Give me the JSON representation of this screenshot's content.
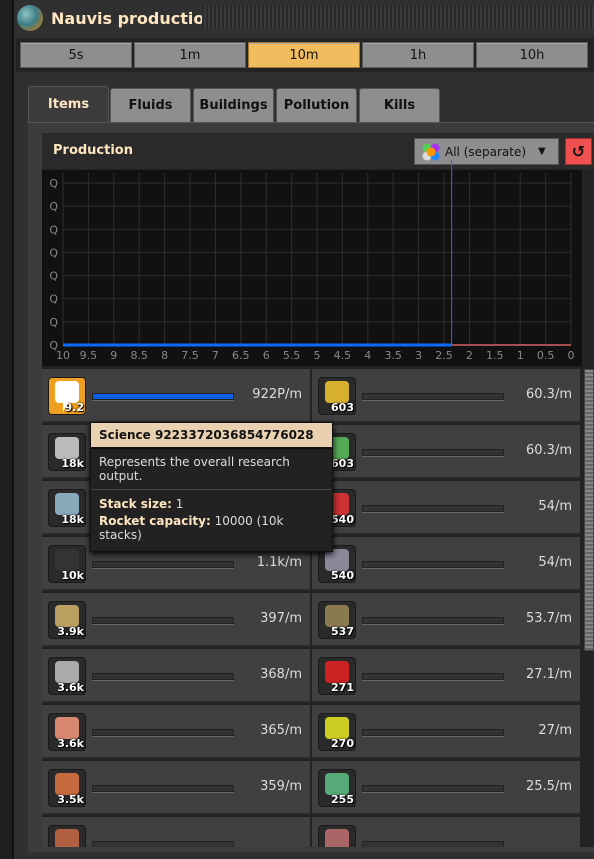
{
  "window": {
    "title": "Nauvis production"
  },
  "time_buttons": [
    {
      "label": "5s"
    },
    {
      "label": "1m"
    },
    {
      "label": "10m",
      "selected": true
    },
    {
      "label": "1h"
    },
    {
      "label": "10h"
    }
  ],
  "tabs": [
    {
      "label": "Items",
      "selected": true
    },
    {
      "label": "Fluids"
    },
    {
      "label": "Buildings"
    },
    {
      "label": "Pollution"
    },
    {
      "label": "Kills"
    }
  ],
  "panel": {
    "title": "Production",
    "filter_dropdown": "All (separate)",
    "reset_icon": "reset-icon"
  },
  "chart_data": {
    "type": "line",
    "x_ticks": [
      "10",
      "9.5",
      "9",
      "8.5",
      "8",
      "7.5",
      "7",
      "6.5",
      "6",
      "5.5",
      "5",
      "4.5",
      "4",
      "3.5",
      "3",
      "2.5",
      "2",
      "1.5",
      "1",
      "0.5",
      "0"
    ],
    "y_ticks": [
      "Q",
      "Q",
      "Q",
      "Q",
      "Q",
      "Q",
      "Q",
      "Q"
    ],
    "xlim": [
      10,
      0
    ],
    "grid": true,
    "cursor_x": 2.35,
    "series": [
      {
        "color": "#0a6cff",
        "points": [
          [
            10,
            0
          ],
          [
            2.35,
            0
          ]
        ]
      },
      {
        "color": "#a05050",
        "points": [
          [
            2.35,
            0
          ],
          [
            0,
            0
          ]
        ]
      }
    ]
  },
  "items_left": [
    {
      "icon": "science-icon",
      "count": "9.2",
      "rate": "922P/m",
      "fill": 1,
      "selected": true
    },
    {
      "icon": "stone-brick-icon",
      "count": "18k",
      "rate": "",
      "fill": 0
    },
    {
      "icon": "iron-ore-icon",
      "count": "18k",
      "rate": "",
      "fill": 0
    },
    {
      "icon": "coal-icon",
      "count": "10k",
      "rate": "1.1k/m",
      "fill": 0
    },
    {
      "icon": "stone-icon",
      "count": "3.9k",
      "rate": "397/m",
      "fill": 0
    },
    {
      "icon": "iron-gear-icon",
      "count": "3.6k",
      "rate": "368/m",
      "fill": 0
    },
    {
      "icon": "copper-plate-icon",
      "count": "3.6k",
      "rate": "365/m",
      "fill": 0
    },
    {
      "icon": "copper-ore-icon",
      "count": "3.5k",
      "rate": "359/m",
      "fill": 0
    },
    {
      "icon": "copper-cable-icon",
      "count": "",
      "rate": "",
      "fill": 0
    }
  ],
  "items_right": [
    {
      "icon": "inserter-icon",
      "count": "603",
      "rate": "60.3/m",
      "fill": 0
    },
    {
      "icon": "electronic-circuit-icon",
      "count": "603",
      "rate": "60.3/m",
      "fill": 0
    },
    {
      "icon": "automation-science-icon",
      "count": "540",
      "rate": "54/m",
      "fill": 0
    },
    {
      "icon": "flask-icon",
      "count": "540",
      "rate": "54/m",
      "fill": 0
    },
    {
      "icon": "wall-icon",
      "count": "537",
      "rate": "53.7/m",
      "fill": 0
    },
    {
      "icon": "curved-rail-red-icon",
      "count": "271",
      "rate": "27.1/m",
      "fill": 0
    },
    {
      "icon": "curved-rail-yellow-icon",
      "count": "270",
      "rate": "27/m",
      "fill": 0
    },
    {
      "icon": "grenade-icon",
      "count": "255",
      "rate": "25.5/m",
      "fill": 0
    },
    {
      "icon": "ammo-icon",
      "count": "",
      "rate": "",
      "fill": 0
    }
  ],
  "tooltip": {
    "title": "Science 9223372036854776028",
    "description": "Represents the overall research output.",
    "stack_label": "Stack size:",
    "stack_value": " 1",
    "rocket_label": "Rocket capacity:",
    "rocket_value": " 10000 (10k stacks)"
  }
}
